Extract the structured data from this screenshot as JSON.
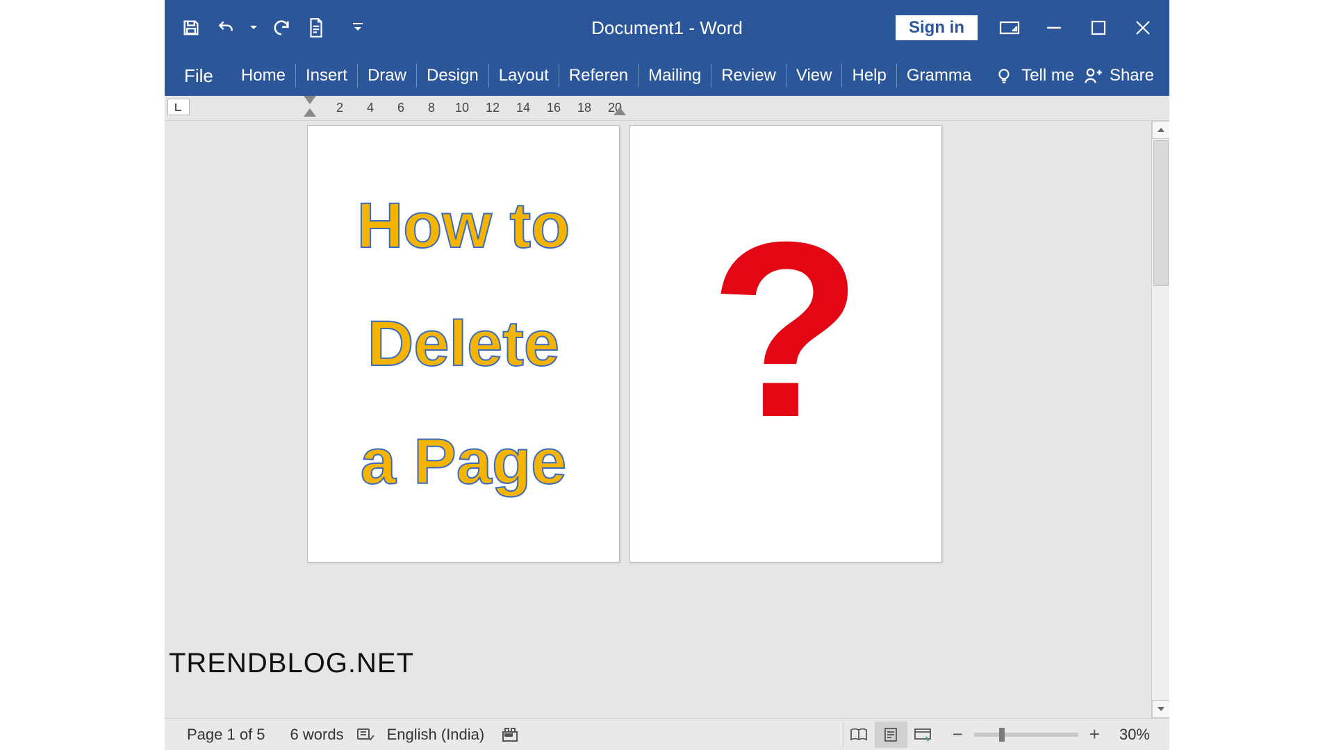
{
  "titlebar": {
    "document_title": "Document1  -  Word",
    "sign_in": "Sign in"
  },
  "ribbon": {
    "file": "File",
    "tabs": [
      "Home",
      "Insert",
      "Draw",
      "Design",
      "Layout",
      "Referen",
      "Mailing",
      "Review",
      "View",
      "Help",
      "Gramma"
    ],
    "tell_me": "Tell me",
    "share": "Share"
  },
  "ruler": {
    "ticks": [
      "2",
      "4",
      "6",
      "8",
      "10",
      "12",
      "14",
      "16",
      "18",
      "20"
    ]
  },
  "document": {
    "page1_line1": "How to",
    "page1_line2": "Delete",
    "page1_line3": "a Page",
    "page2_text": "?"
  },
  "statusbar": {
    "page": "Page 1 of 5",
    "words": "6 words",
    "language": "English (India)",
    "zoom": "30%"
  },
  "watermark": "TRENDBLOG.NET"
}
